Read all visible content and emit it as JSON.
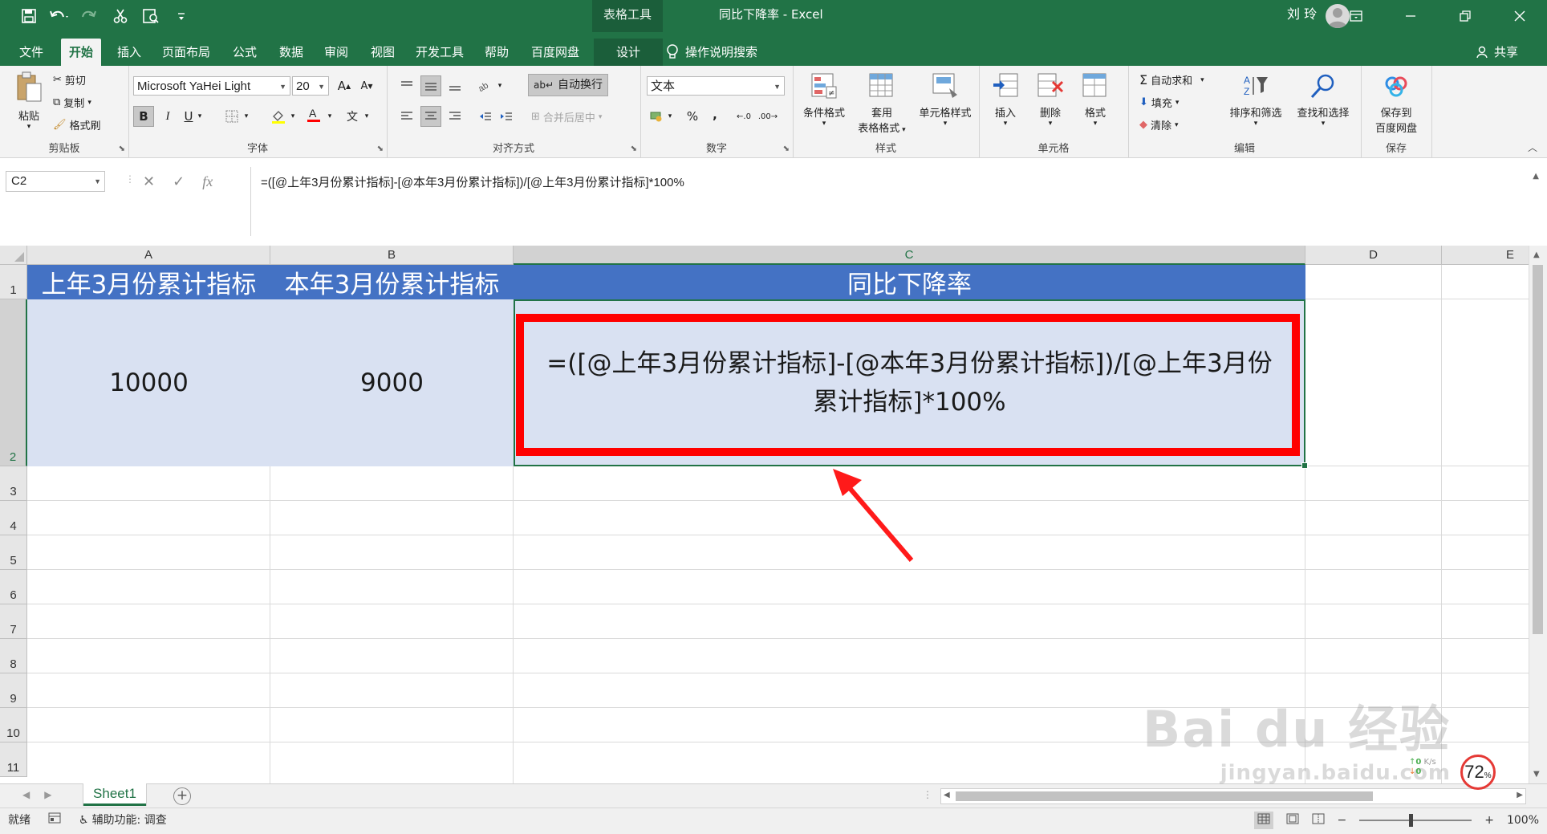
{
  "window": {
    "context_title": "表格工具",
    "doc_title": "同比下降率 - Excel",
    "user_name": "刘 玲"
  },
  "tabs": [
    {
      "label": "文件"
    },
    {
      "label": "开始"
    },
    {
      "label": "插入"
    },
    {
      "label": "页面布局"
    },
    {
      "label": "公式"
    },
    {
      "label": "数据"
    },
    {
      "label": "审阅"
    },
    {
      "label": "视图"
    },
    {
      "label": "开发工具"
    },
    {
      "label": "帮助"
    },
    {
      "label": "百度网盘"
    },
    {
      "label": "设计"
    }
  ],
  "tell_me": "操作说明搜索",
  "share": "共享",
  "ribbon": {
    "clipboard": {
      "label": "剪贴板",
      "paste": "粘贴",
      "cut": "剪切",
      "copy": "复制",
      "format_painter": "格式刷"
    },
    "font": {
      "label": "字体",
      "name": "Microsoft YaHei Light",
      "size": "20",
      "bold": "B",
      "italic": "I",
      "underline": "U"
    },
    "alignment": {
      "label": "对齐方式",
      "wrap": "自动换行",
      "merge": "合并后居中"
    },
    "number": {
      "label": "数字",
      "format": "文本",
      "percent": "%",
      "comma": ","
    },
    "styles": {
      "label": "样式",
      "conditional": "条件格式",
      "table_line1": "套用",
      "table_line2": "表格格式",
      "cell_styles": "单元格样式"
    },
    "cells": {
      "label": "单元格",
      "insert": "插入",
      "delete": "删除",
      "format": "格式"
    },
    "editing": {
      "label": "编辑",
      "autosum": "自动求和",
      "fill": "填充",
      "clear": "清除",
      "sort": "排序和筛选",
      "find": "查找和选择"
    },
    "save": {
      "label": "保存",
      "line1": "保存到",
      "line2": "百度网盘"
    }
  },
  "formula_bar": {
    "name_box": "C2",
    "formula": "=([@上年3月份累计指标]-[@本年3月份累计指标])/[@上年3月份累计指标]*100%"
  },
  "sheet": {
    "columns": [
      "A",
      "B",
      "C",
      "D",
      "E"
    ],
    "rows": [
      "1",
      "2",
      "3",
      "4",
      "5",
      "6",
      "7",
      "8",
      "9",
      "10",
      "11"
    ],
    "headers": [
      "上年3月份累计指标",
      "本年3月份累计指标",
      "同比下降率"
    ],
    "row2": {
      "a": "10000",
      "b": "9000",
      "c": "=([@上年3月份累计指标]-[@本年3月份累计指标])/[@上年3月份累计指标]*100%"
    }
  },
  "sheet_tabs": [
    {
      "label": "Sheet1"
    }
  ],
  "status": {
    "ready": "就绪",
    "accessibility": "辅助功能: 调查",
    "zoom": "100%"
  },
  "watermark": {
    "brand": "Bai du 经验",
    "url": "jingyan.baidu.com"
  },
  "net_widget": {
    "up": "0",
    "down": "0",
    "unit": "K/s",
    "percent": "72",
    "percent_sign": "%"
  },
  "colors": {
    "excel_green": "#217346",
    "table_header": "#4472c4",
    "table_row": "#d9e1f2",
    "highlight": "#ff0000"
  }
}
